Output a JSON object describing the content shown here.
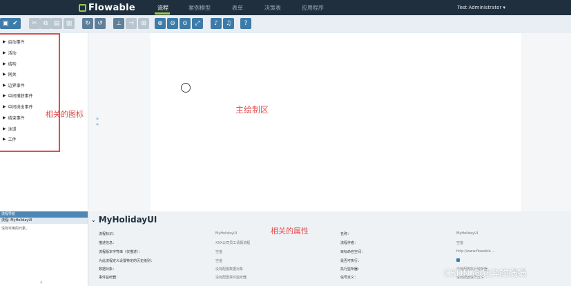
{
  "app": {
    "logo": "Flowable",
    "brand_color": "#9cc94a",
    "nav_bg": "#1f2f3d"
  },
  "nav": {
    "tabs": [
      "流程",
      "案例模型",
      "表单",
      "决策表",
      "应用程序"
    ],
    "active": "流程",
    "user": "Test Administrator ▾"
  },
  "toolbar": {
    "icons": [
      "save-icon",
      "check-icon",
      "cut-icon",
      "copy-icon",
      "paste-icon",
      "delete-icon",
      "redo-icon",
      "undo-icon",
      "align-vertical-icon",
      "align-horizontal-icon",
      "same-size-icon",
      "zoom-in-icon",
      "zoom-out-icon",
      "zoom-actual-icon",
      "zoom-fit-icon",
      "bend-add-icon",
      "bend-remove-icon",
      "help-icon"
    ]
  },
  "palette": {
    "items": [
      "启动事件",
      "活动",
      "结构",
      "网关",
      "边界事件",
      "中间捕获事件",
      "中间抛出事件",
      "结束事件",
      "泳道",
      "工件"
    ]
  },
  "annotations": {
    "palette": "相关的图标",
    "canvas": "主绘制区",
    "properties": "相关的属性"
  },
  "navigator": {
    "header": "流程导航",
    "row": "流程: MyHolidayUI",
    "empty": "没有可用的元素。"
  },
  "properties": {
    "title": "MyHolidayUI",
    "left": [
      {
        "label": "流程标识：",
        "value": "MyHolidayUI"
      },
      {
        "label": "描述信息：",
        "value": "XXX公司员工请假流程"
      },
      {
        "label": "流程版本字符串（仅描述）：",
        "value": "空值"
      },
      {
        "label": "为此流程定义设置特定的历史级别：",
        "value": "空值"
      },
      {
        "label": "数据对象：",
        "value": "没有配置数据对象"
      },
      {
        "label": "事件监听器：",
        "value": "没有配置事件监听器"
      }
    ],
    "right": [
      {
        "label": "名称：",
        "value": "MyHolidayUI"
      },
      {
        "label": "流程作者：",
        "value": "空值"
      },
      {
        "label": "目标命名空间：",
        "value": "http://www.flowable ..."
      },
      {
        "label": "是否可执行：",
        "value": ""
      },
      {
        "label": "执行监听器：",
        "value": "没有配置执行监听器"
      },
      {
        "label": "信号定义：",
        "value": "没有配置信号定义"
      }
    ]
  },
  "watermark": "CSDN @狂奔的蜗蜗"
}
